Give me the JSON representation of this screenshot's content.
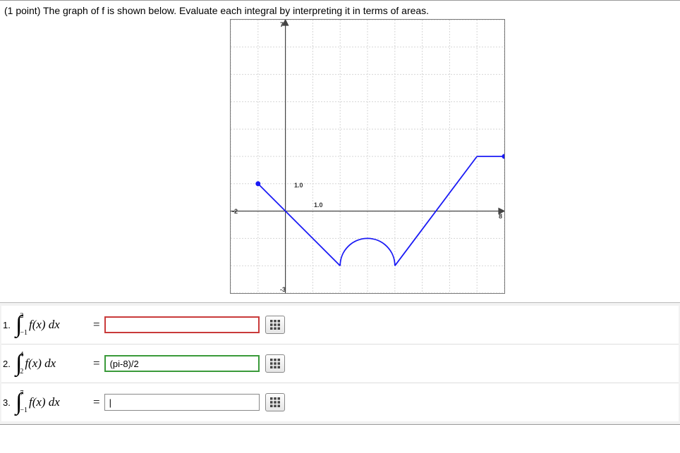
{
  "prompt": {
    "points_label": "(1 point)",
    "text": "The graph of f is shown below. Evaluate each integral by interpreting it in terms of areas."
  },
  "questions": [
    {
      "num": "1.",
      "lower": "−1",
      "upper": "2",
      "value": "",
      "state": "red"
    },
    {
      "num": "2.",
      "lower": "2",
      "upper": "4",
      "value": "(pi-8)/2",
      "state": "green"
    },
    {
      "num": "3.",
      "lower": "−1",
      "upper": "7",
      "value": "|",
      "state": "plain"
    }
  ],
  "integrand": "f(x) dx",
  "equals": "=",
  "chart_data": {
    "type": "line",
    "title": "",
    "xlabel": "",
    "ylabel": "",
    "xlim": [
      -2,
      8
    ],
    "ylim": [
      -3,
      7
    ],
    "grid": true,
    "annotations": [
      {
        "text": "1.0",
        "x": 0,
        "y": 1
      },
      {
        "text": "1.0",
        "x": 1,
        "y": 0
      },
      {
        "text": "-2",
        "x": -2,
        "y": 0
      },
      {
        "text": "-3",
        "x": 0,
        "y": -3
      },
      {
        "text": "7",
        "x": 0,
        "y": 7
      },
      {
        "text": "8",
        "x": 8,
        "y": 0
      }
    ],
    "series": [
      {
        "name": "segment_a",
        "type": "line",
        "points": [
          [
            -1,
            1
          ],
          [
            2,
            -2
          ]
        ]
      },
      {
        "name": "semicircle",
        "type": "arc",
        "center": [
          3,
          -2
        ],
        "radius": 1,
        "start_angle_deg": 180,
        "end_angle_deg": 0,
        "direction": "upper"
      },
      {
        "name": "segment_b",
        "type": "line",
        "points": [
          [
            4,
            -2
          ],
          [
            7,
            2
          ]
        ]
      },
      {
        "name": "segment_c",
        "type": "line",
        "points": [
          [
            7,
            2
          ],
          [
            8,
            2
          ]
        ]
      }
    ],
    "endpoints": [
      [
        -1,
        1
      ],
      [
        8,
        2
      ]
    ]
  }
}
